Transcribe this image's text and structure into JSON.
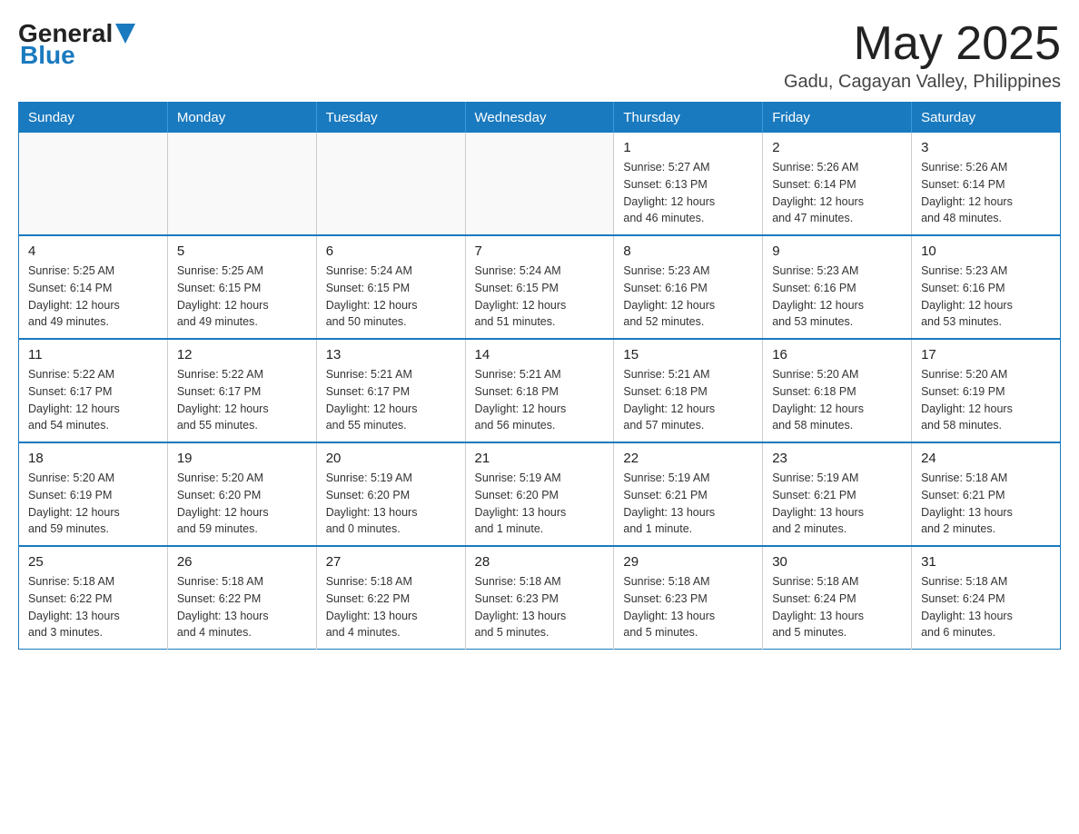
{
  "header": {
    "logo_general": "General",
    "logo_blue": "Blue",
    "month_title": "May 2025",
    "location": "Gadu, Cagayan Valley, Philippines"
  },
  "days_of_week": [
    "Sunday",
    "Monday",
    "Tuesday",
    "Wednesday",
    "Thursday",
    "Friday",
    "Saturday"
  ],
  "weeks": [
    [
      {
        "day": "",
        "info": ""
      },
      {
        "day": "",
        "info": ""
      },
      {
        "day": "",
        "info": ""
      },
      {
        "day": "",
        "info": ""
      },
      {
        "day": "1",
        "info": "Sunrise: 5:27 AM\nSunset: 6:13 PM\nDaylight: 12 hours\nand 46 minutes."
      },
      {
        "day": "2",
        "info": "Sunrise: 5:26 AM\nSunset: 6:14 PM\nDaylight: 12 hours\nand 47 minutes."
      },
      {
        "day": "3",
        "info": "Sunrise: 5:26 AM\nSunset: 6:14 PM\nDaylight: 12 hours\nand 48 minutes."
      }
    ],
    [
      {
        "day": "4",
        "info": "Sunrise: 5:25 AM\nSunset: 6:14 PM\nDaylight: 12 hours\nand 49 minutes."
      },
      {
        "day": "5",
        "info": "Sunrise: 5:25 AM\nSunset: 6:15 PM\nDaylight: 12 hours\nand 49 minutes."
      },
      {
        "day": "6",
        "info": "Sunrise: 5:24 AM\nSunset: 6:15 PM\nDaylight: 12 hours\nand 50 minutes."
      },
      {
        "day": "7",
        "info": "Sunrise: 5:24 AM\nSunset: 6:15 PM\nDaylight: 12 hours\nand 51 minutes."
      },
      {
        "day": "8",
        "info": "Sunrise: 5:23 AM\nSunset: 6:16 PM\nDaylight: 12 hours\nand 52 minutes."
      },
      {
        "day": "9",
        "info": "Sunrise: 5:23 AM\nSunset: 6:16 PM\nDaylight: 12 hours\nand 53 minutes."
      },
      {
        "day": "10",
        "info": "Sunrise: 5:23 AM\nSunset: 6:16 PM\nDaylight: 12 hours\nand 53 minutes."
      }
    ],
    [
      {
        "day": "11",
        "info": "Sunrise: 5:22 AM\nSunset: 6:17 PM\nDaylight: 12 hours\nand 54 minutes."
      },
      {
        "day": "12",
        "info": "Sunrise: 5:22 AM\nSunset: 6:17 PM\nDaylight: 12 hours\nand 55 minutes."
      },
      {
        "day": "13",
        "info": "Sunrise: 5:21 AM\nSunset: 6:17 PM\nDaylight: 12 hours\nand 55 minutes."
      },
      {
        "day": "14",
        "info": "Sunrise: 5:21 AM\nSunset: 6:18 PM\nDaylight: 12 hours\nand 56 minutes."
      },
      {
        "day": "15",
        "info": "Sunrise: 5:21 AM\nSunset: 6:18 PM\nDaylight: 12 hours\nand 57 minutes."
      },
      {
        "day": "16",
        "info": "Sunrise: 5:20 AM\nSunset: 6:18 PM\nDaylight: 12 hours\nand 58 minutes."
      },
      {
        "day": "17",
        "info": "Sunrise: 5:20 AM\nSunset: 6:19 PM\nDaylight: 12 hours\nand 58 minutes."
      }
    ],
    [
      {
        "day": "18",
        "info": "Sunrise: 5:20 AM\nSunset: 6:19 PM\nDaylight: 12 hours\nand 59 minutes."
      },
      {
        "day": "19",
        "info": "Sunrise: 5:20 AM\nSunset: 6:20 PM\nDaylight: 12 hours\nand 59 minutes."
      },
      {
        "day": "20",
        "info": "Sunrise: 5:19 AM\nSunset: 6:20 PM\nDaylight: 13 hours\nand 0 minutes."
      },
      {
        "day": "21",
        "info": "Sunrise: 5:19 AM\nSunset: 6:20 PM\nDaylight: 13 hours\nand 1 minute."
      },
      {
        "day": "22",
        "info": "Sunrise: 5:19 AM\nSunset: 6:21 PM\nDaylight: 13 hours\nand 1 minute."
      },
      {
        "day": "23",
        "info": "Sunrise: 5:19 AM\nSunset: 6:21 PM\nDaylight: 13 hours\nand 2 minutes."
      },
      {
        "day": "24",
        "info": "Sunrise: 5:18 AM\nSunset: 6:21 PM\nDaylight: 13 hours\nand 2 minutes."
      }
    ],
    [
      {
        "day": "25",
        "info": "Sunrise: 5:18 AM\nSunset: 6:22 PM\nDaylight: 13 hours\nand 3 minutes."
      },
      {
        "day": "26",
        "info": "Sunrise: 5:18 AM\nSunset: 6:22 PM\nDaylight: 13 hours\nand 4 minutes."
      },
      {
        "day": "27",
        "info": "Sunrise: 5:18 AM\nSunset: 6:22 PM\nDaylight: 13 hours\nand 4 minutes."
      },
      {
        "day": "28",
        "info": "Sunrise: 5:18 AM\nSunset: 6:23 PM\nDaylight: 13 hours\nand 5 minutes."
      },
      {
        "day": "29",
        "info": "Sunrise: 5:18 AM\nSunset: 6:23 PM\nDaylight: 13 hours\nand 5 minutes."
      },
      {
        "day": "30",
        "info": "Sunrise: 5:18 AM\nSunset: 6:24 PM\nDaylight: 13 hours\nand 5 minutes."
      },
      {
        "day": "31",
        "info": "Sunrise: 5:18 AM\nSunset: 6:24 PM\nDaylight: 13 hours\nand 6 minutes."
      }
    ]
  ]
}
